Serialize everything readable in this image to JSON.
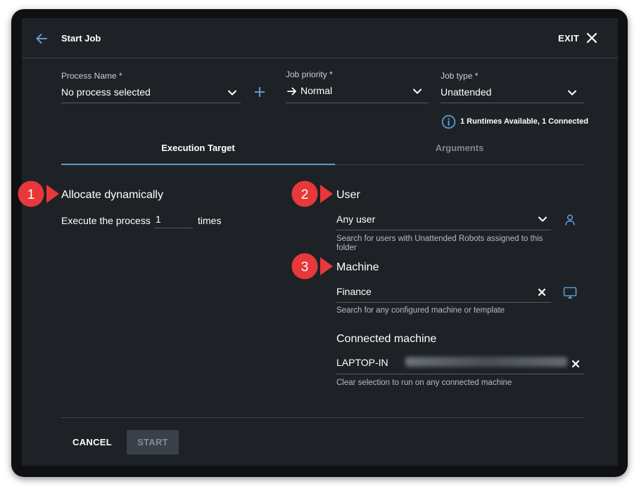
{
  "header": {
    "title": "Start Job",
    "exit_label": "EXIT"
  },
  "fields": {
    "process": {
      "label": "Process Name *",
      "value": "No process selected"
    },
    "priority": {
      "label": "Job priority *",
      "value": "Normal"
    },
    "job_type": {
      "label": "Job type *",
      "value": "Unattended"
    }
  },
  "runtimes_info": "1 Runtimes Available, 1 Connected",
  "tabs": [
    {
      "label": "Execution Target",
      "active": true
    },
    {
      "label": "Arguments",
      "active": false
    }
  ],
  "allocate": {
    "title": "Allocate dynamically",
    "execute_prefix": "Execute the process",
    "count": "1",
    "execute_suffix": "times"
  },
  "user": {
    "title": "User",
    "value": "Any user",
    "helper": "Search for users with Unattended Robots assigned to this folder"
  },
  "machine": {
    "title": "Machine",
    "value": "Finance",
    "helper": "Search for any configured machine or template"
  },
  "connected_machine": {
    "title": "Connected machine",
    "value_prefix": "LAPTOP-IN",
    "helper": "Clear selection to run on any connected machine"
  },
  "footer": {
    "cancel_label": "CANCEL",
    "start_label": "START"
  },
  "callouts": [
    "1",
    "2",
    "3"
  ],
  "colors": {
    "accent": "#5b9bd5",
    "callout": "#e8383b",
    "dialog_bg": "#1e2226"
  }
}
